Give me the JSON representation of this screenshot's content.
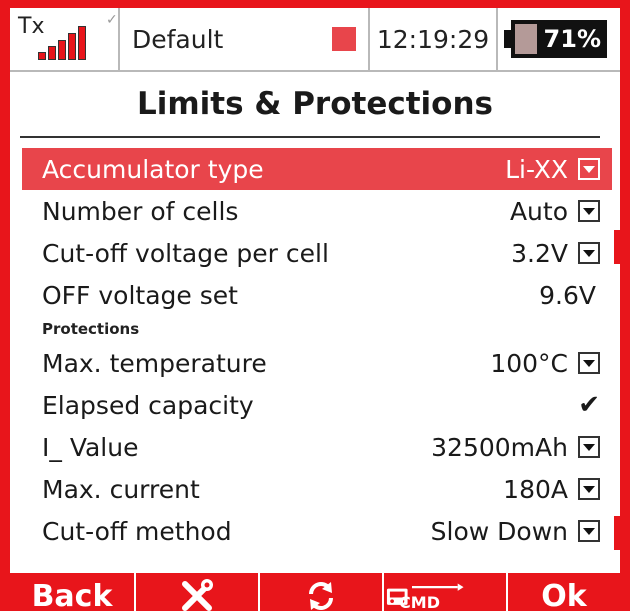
{
  "status": {
    "tx_label": "Tx",
    "model_name": "Default",
    "time": "12:19:29",
    "battery_percent": "71%",
    "battery_level": 0.25
  },
  "title": "Limits & Protections",
  "rows": [
    {
      "label": "Accumulator type",
      "value": "Li-XX",
      "dropdown": true,
      "selected": true
    },
    {
      "label": "Number of cells",
      "value": "Auto",
      "dropdown": true
    },
    {
      "label": "Cut-off voltage per cell",
      "value": "3.2V",
      "dropdown": true
    },
    {
      "label": "OFF voltage set",
      "value": "9.6V",
      "dropdown": false
    }
  ],
  "section_label": "Protections",
  "rows2": [
    {
      "label": "Max. temperature",
      "value": "100°C",
      "dropdown": true
    },
    {
      "label": "Elapsed capacity",
      "value": "✔",
      "dropdown": false
    },
    {
      "label": "I_ Value",
      "value": "32500mAh",
      "dropdown": true
    },
    {
      "label": "Max. current",
      "value": "180A",
      "dropdown": true
    },
    {
      "label": "Cut-off method",
      "value": "Slow Down",
      "dropdown": true
    }
  ],
  "bottom": {
    "back": "Back",
    "ok": "Ok",
    "cmd": "CMD"
  },
  "colors": {
    "accent": "#e8151b",
    "selected_row": "#e8454b"
  },
  "icons": [
    "wrench-screwdriver-icon",
    "refresh-icon",
    "transmitter-cmd-icon"
  ]
}
